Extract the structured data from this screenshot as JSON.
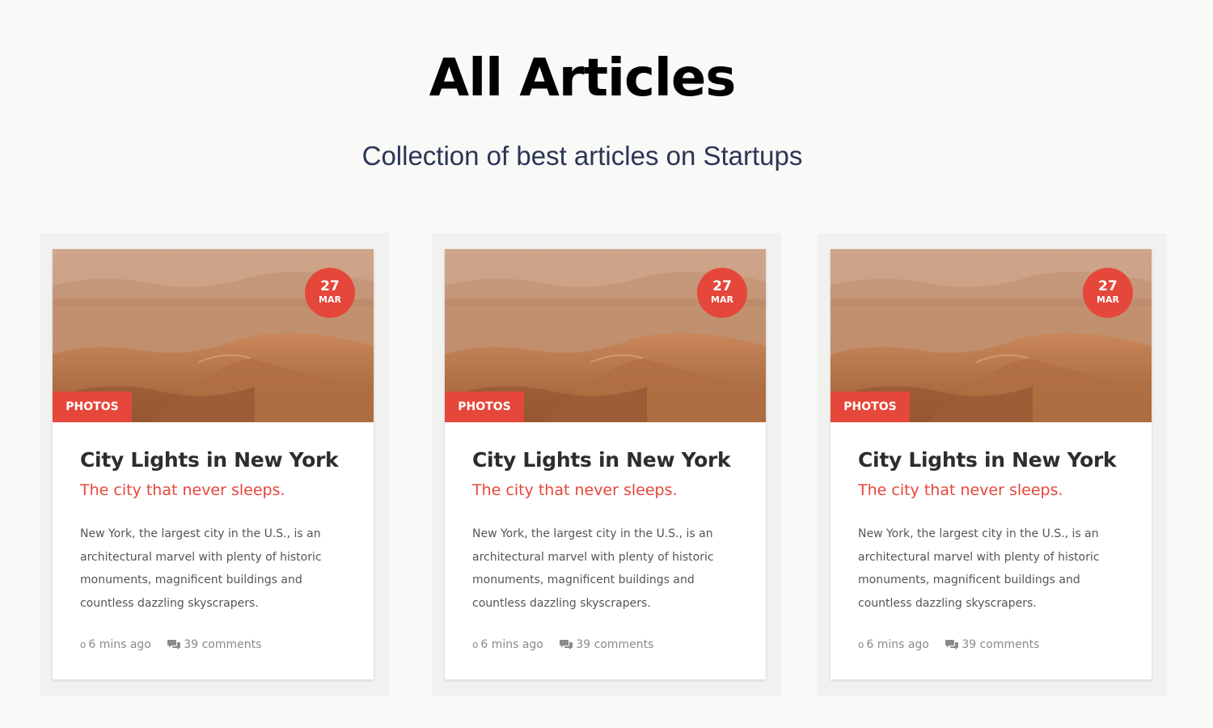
{
  "header": {
    "title": "All Articles",
    "subtitle": "Collection of best articles on Startups"
  },
  "articles": [
    {
      "date_day": "27",
      "date_month": "MAR",
      "category": "PHOTOS",
      "title": "City Lights in New York",
      "tagline": "The city that never sleeps.",
      "excerpt_lines": [
        "New York, the largest city in the U.S., is an",
        "architectural marvel with plenty of historic",
        "monuments, magnificent buildings and",
        "countless dazzling skyscrapers."
      ],
      "time_icon": "o",
      "time_ago": "6 mins ago",
      "comments": "39 comments"
    },
    {
      "date_day": "27",
      "date_month": "MAR",
      "category": "PHOTOS",
      "title": "City Lights in New York",
      "tagline": "The city that never sleeps.",
      "excerpt_lines": [
        "New York, the largest city in the U.S., is an",
        "architectural marvel with plenty of historic",
        "monuments, magnificent buildings and",
        "countless dazzling skyscrapers."
      ],
      "time_icon": "o",
      "time_ago": "6 mins ago",
      "comments": "39 comments"
    },
    {
      "date_day": "27",
      "date_month": "MAR",
      "category": "PHOTOS",
      "title": "City Lights in New York",
      "tagline": "The city that never sleeps.",
      "excerpt_lines": [
        "New York, the largest city in the U.S., is an",
        "architectural marvel with plenty of historic",
        "monuments, magnificent buildings and",
        "countless dazzling skyscrapers."
      ],
      "time_icon": "o",
      "time_ago": "6 mins ago",
      "comments": "39 comments"
    }
  ],
  "colors": {
    "accent": "#e5473a",
    "title_text": "#000000",
    "subtitle_text": "#2b3557",
    "card_title": "#2d2d2d",
    "body_text": "#555555",
    "meta_text": "#8a8a8a"
  },
  "icons": {
    "time": "clock-icon",
    "comments": "comment-icon",
    "image": "desert-dunes-photo"
  }
}
